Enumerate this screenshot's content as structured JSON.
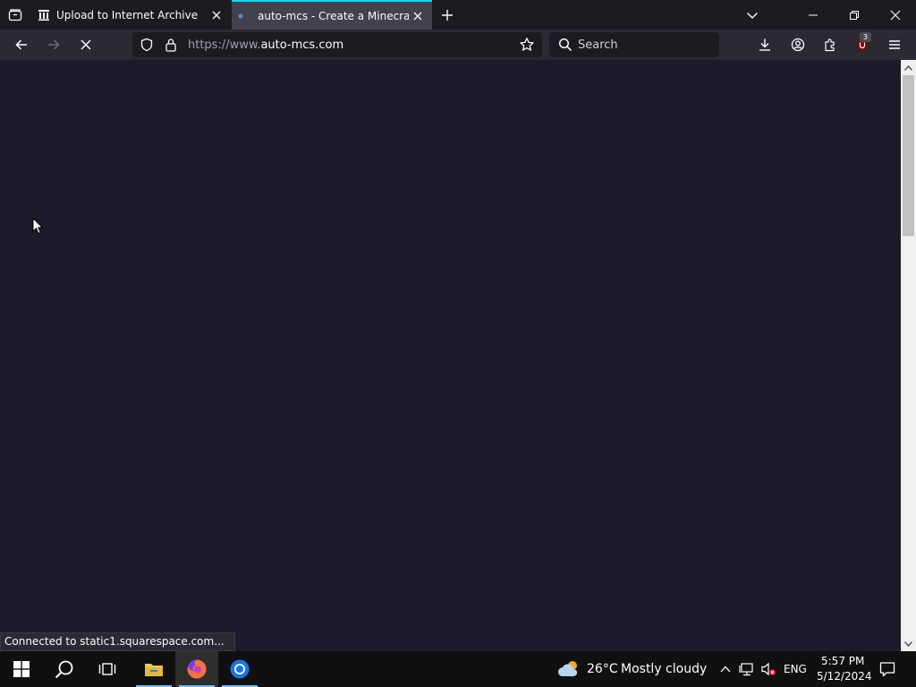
{
  "browser": {
    "tabs": [
      {
        "title": "Upload to Internet Archive",
        "icon": "internet-archive-icon",
        "active": false
      },
      {
        "title": "auto-mcs - Create a Minecraft S",
        "icon": "loading-dot-icon",
        "active": true
      }
    ],
    "url": {
      "prefix": "https://www.",
      "domain": "auto-mcs.com"
    },
    "search_placeholder": "Search",
    "extension_badge": "3",
    "status_text": "Connected to static1.squarespace.com..."
  },
  "taskbar": {
    "weather": {
      "temperature": "26°C",
      "description": "Mostly cloudy"
    },
    "language": "ENG",
    "time": "5:57 PM",
    "date": "5/12/2024"
  },
  "colors": {
    "page_background": "#1c1b2c",
    "active_tab_accent": "#00ddff",
    "taskbar_accent": "#76b9ed"
  }
}
